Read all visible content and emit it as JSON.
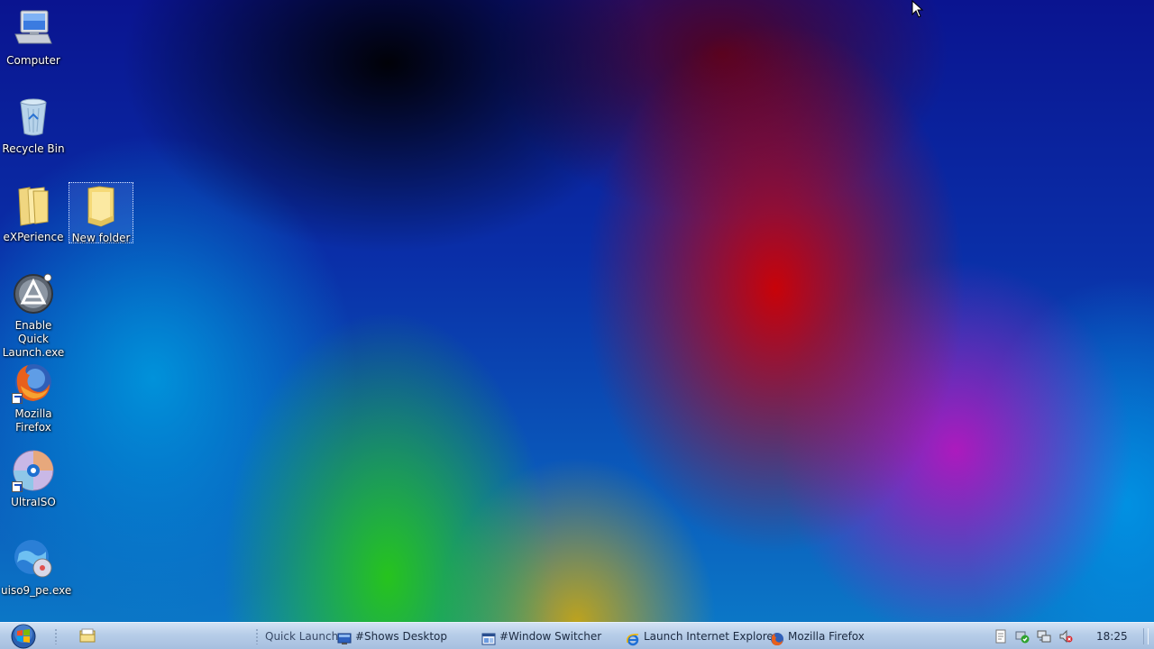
{
  "desktop": {
    "icons": [
      {
        "label": "Computer",
        "icon": "computer-icon"
      },
      {
        "label": "Recycle Bin",
        "icon": "recycle-bin-icon"
      },
      {
        "label": "eXPerience",
        "icon": "folder-icon"
      },
      {
        "label": "New folder",
        "icon": "folder-icon",
        "selected": true
      },
      {
        "label": "Enable Quick Launch.exe",
        "icon": "app-exe-icon"
      },
      {
        "label": "Mozilla Firefox",
        "icon": "firefox-icon"
      },
      {
        "label": "UltraISO",
        "icon": "ultraiso-disc-icon"
      },
      {
        "label": "uiso9_pe.exe",
        "icon": "uiso-installer-icon"
      }
    ]
  },
  "taskbar": {
    "start_icon": "windows-start-orb-icon",
    "quick_launch_label": "Quick Launch",
    "items": [
      {
        "label": "#Shows Desktop",
        "icon": "show-desktop-icon"
      },
      {
        "label": "#Window Switcher",
        "icon": "window-switcher-icon"
      },
      {
        "label": "Launch Internet Explore...",
        "icon": "internet-explorer-icon"
      },
      {
        "label": "Mozilla Firefox",
        "icon": "firefox-icon"
      }
    ],
    "tray_icons": [
      "notes-icon",
      "security-check-icon",
      "network-icon",
      "volume-muted-icon"
    ],
    "clock": "18:25"
  },
  "colors": {
    "taskbar_top": "#d2e2f4",
    "taskbar_bottom": "#a6bfdf",
    "desktop_text": "#ffffff"
  }
}
